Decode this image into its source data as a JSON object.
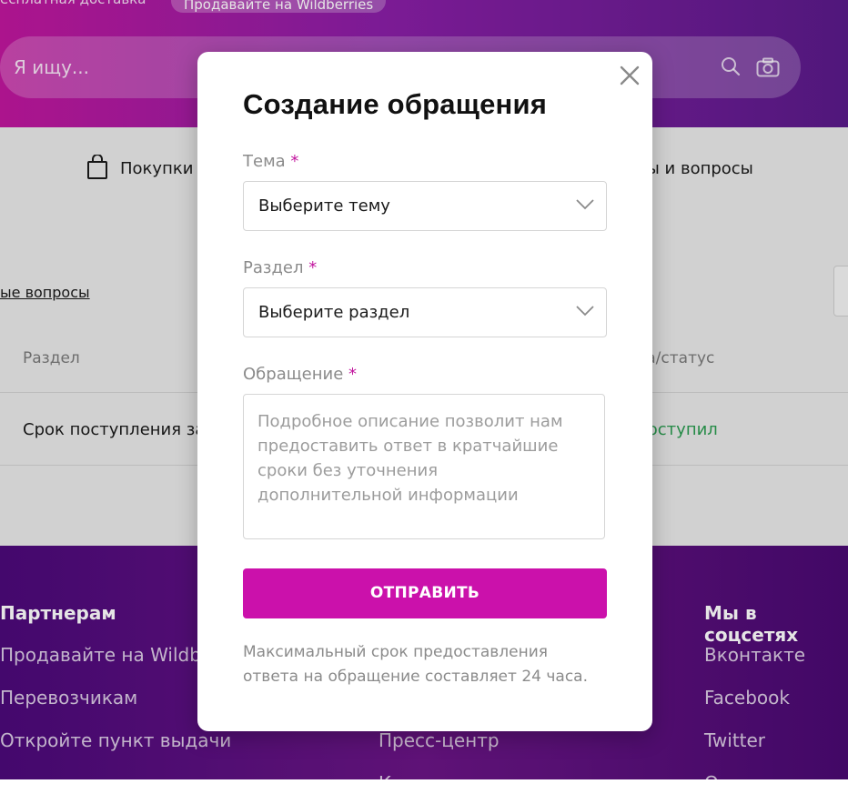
{
  "header": {
    "free_delivery": "есплатная доставка",
    "sell_pill": "Продавайте на Wildberries",
    "search_placeholder": "Я ищу...",
    "search_icon": "search-icon",
    "camera_icon": "camera-icon"
  },
  "subnav": {
    "purchases": "Покупки",
    "reviews": "вы и вопросы",
    "bag_icon": "shopping-bag-icon"
  },
  "content": {
    "faq_link": "ые вопросы",
    "col_section": "Раздел",
    "col_status": "ка/статус",
    "row_text": "Срок поступления за",
    "row_status": "поступил",
    "status_color": "#2a9b50"
  },
  "footer": {
    "partners_head": "Партнерам",
    "partners_links": [
      "Продавайте на Wildb",
      "Перевозчикам",
      "Откройте пункт выдачи"
    ],
    "mid_link": "Пресс-центр",
    "mid_link2": "К",
    "social_head": "Мы в соцсетях",
    "social_links": [
      "Вконтакте",
      "Facebook",
      "Twitter",
      "О"
    ]
  },
  "modal": {
    "title": "Создание обращения",
    "close_icon": "close-icon",
    "topic_label": "Тема",
    "topic_placeholder": "Выберите тему",
    "section_label": "Раздел",
    "section_placeholder": "Выберите раздел",
    "message_label": "Обращение",
    "message_placeholder": "Подробное описание позволит нам предоставить ответ в кратчайшие сроки без уточнения дополнительной информации",
    "required_mark": "*",
    "submit_label": "ОТПРАВИТЬ",
    "note": "Максимальный срок предоставления ответа на обращение составляет 24 часа.",
    "accent_color": "#cb11ab"
  }
}
